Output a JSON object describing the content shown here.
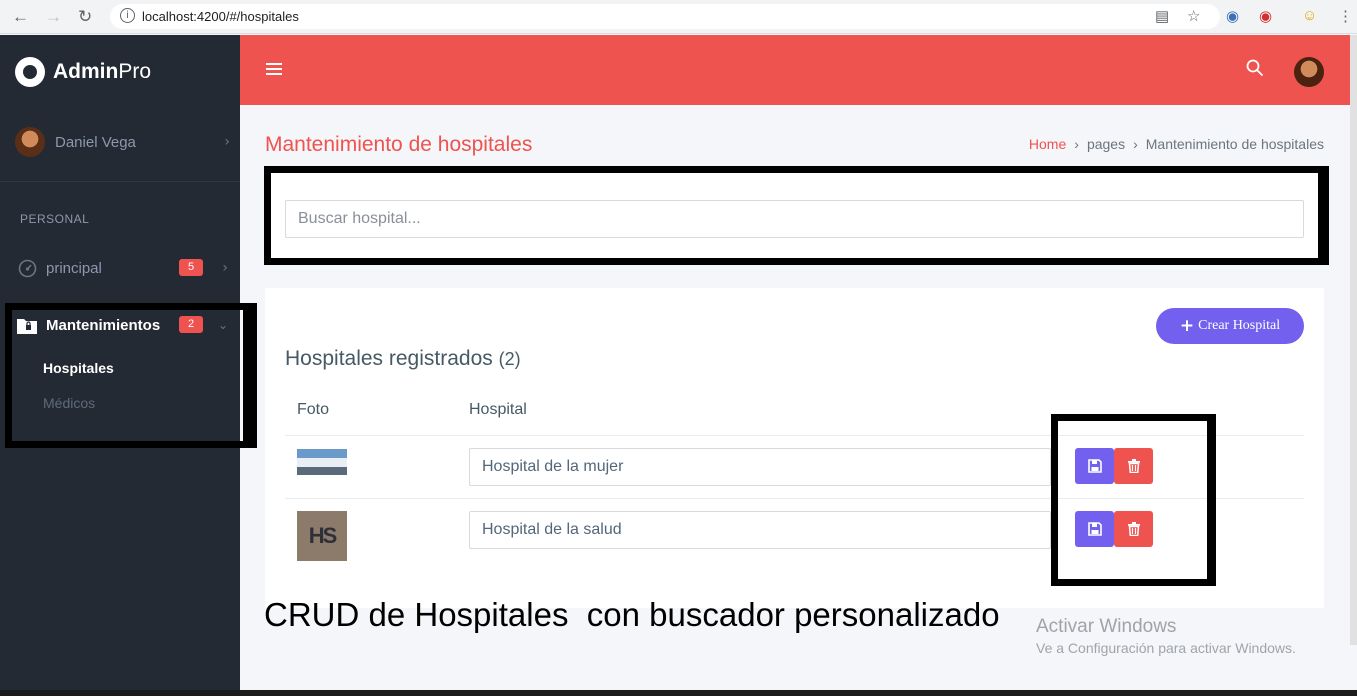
{
  "browser": {
    "url": "localhost:4200/#/hospitales"
  },
  "brand": {
    "bold": "Admin",
    "light": "Pro"
  },
  "user": {
    "name": "Daniel Vega"
  },
  "sidebar": {
    "section": "PERSONAL",
    "items": [
      {
        "label": "principal",
        "badge": "5"
      },
      {
        "label": "Mantenimientos",
        "badge": "2"
      }
    ],
    "submenu": [
      "Hospitales",
      "Médicos"
    ]
  },
  "page": {
    "title": "Mantenimiento de hospitales",
    "breadcrumb": [
      "Home",
      "pages",
      "Mantenimiento de hospitales"
    ]
  },
  "search": {
    "placeholder": "Buscar hospital..."
  },
  "card": {
    "create_label": "Crear Hospital",
    "title": "Hospitales registrados",
    "count": "(2)",
    "columns": [
      "Foto",
      "Hospital"
    ],
    "rows": [
      {
        "name": "Hospital de la mujer"
      },
      {
        "name": "Hospital de la salud",
        "thumb_text": "HS"
      }
    ]
  },
  "caption": "CRUD de Hospitales  con buscador personalizado",
  "watermark": {
    "title": "Activar Windows",
    "subtitle": "Ve a Configuración para activar Windows."
  },
  "colors": {
    "primary": "#ef5350",
    "accent": "#7460ee",
    "sidebar": "#242a33"
  }
}
